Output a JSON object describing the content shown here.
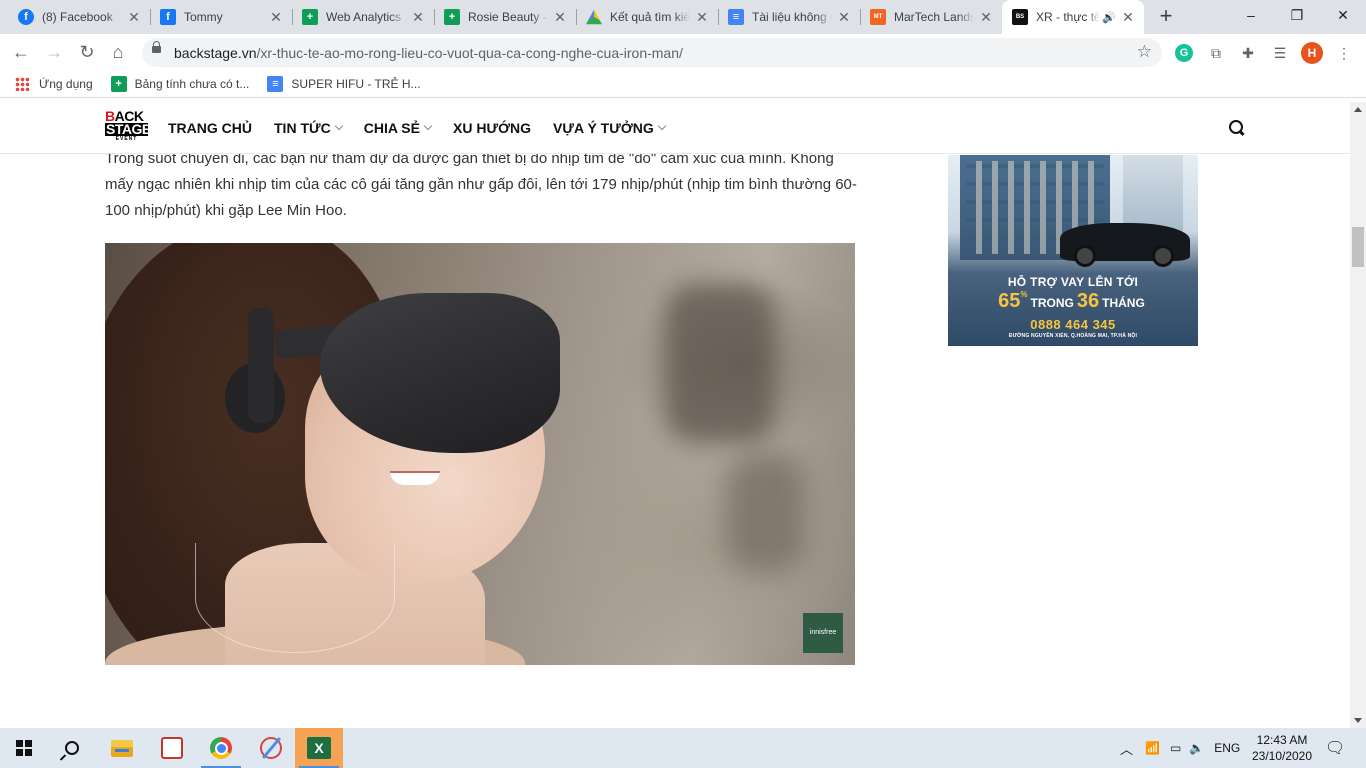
{
  "browser": {
    "tabs": [
      {
        "title": "(8) Facebook",
        "favicon": "facebook-icon"
      },
      {
        "title": "Tommy",
        "favicon": "facebook-icon"
      },
      {
        "title": "Web Analytics",
        "favicon": "google-sheets-icon"
      },
      {
        "title": "Rosie Beauty -",
        "favicon": "google-sheets-icon"
      },
      {
        "title": "Kết quả tìm kiếm",
        "favicon": "google-drive-icon"
      },
      {
        "title": "Tài liệu không có",
        "favicon": "google-docs-icon"
      },
      {
        "title": "MarTech Landscape",
        "favicon": "martech-icon"
      },
      {
        "title": "XR - thực tế",
        "favicon": "backstage-icon",
        "active": true,
        "audio": true
      }
    ],
    "url_domain": "backstage.vn",
    "url_path": "/xr-thuc-te-ao-mo-rong-lieu-co-vuot-qua-ca-cong-nghe-cua-iron-man/",
    "profile_initial": "H",
    "bookmarks": [
      {
        "label": "Ứng dụng",
        "icon": "apps-grid-icon"
      },
      {
        "label": "Bảng tính chưa có t...",
        "icon": "google-sheets-icon"
      },
      {
        "label": "SUPER HIFU - TRẺ H...",
        "icon": "google-docs-icon"
      }
    ]
  },
  "site": {
    "logo": {
      "line1_a": "B",
      "line1_b": "ACK",
      "line2": "STAGE",
      "line3": "EVENT"
    },
    "menu": [
      {
        "label": "TRANG CHỦ",
        "dropdown": false
      },
      {
        "label": "TIN TỨC",
        "dropdown": true
      },
      {
        "label": "CHIA SẺ",
        "dropdown": true
      },
      {
        "label": "XU HƯỚNG",
        "dropdown": false
      },
      {
        "label": "VỰA Ý TƯỞNG",
        "dropdown": true
      }
    ]
  },
  "article": {
    "paragraph": "Trong suốt chuyến đi, các bạn nữ tham dự đã được gắn thiết bị đo nhịp tim để \"đo\" cảm xúc của mình. Không mấy ngạc nhiên khi nhịp tim của các cô gái tăng gần như gấp đôi, lên tới 179 nhịp/phút (nhịp tim bình thường 60-100 nhịp/phút) khi gặp Lee Min Hoo.",
    "image_watermark": "innisfree",
    "headset_brand": "innisfree"
  },
  "ad": {
    "title": "HỖ TRỢ VAY LÊN TỚI",
    "percent": "65",
    "percent_sign": "%",
    "trong": "TRONG",
    "months": "36",
    "thang": "THÁNG",
    "phone": "0888 464 345",
    "address": "ĐƯỜNG NGUYỄN XIỂN, Q.HOÀNG MAI, TP.HÀ NỘI"
  },
  "taskbar": {
    "language": "ENG",
    "time": "12:43 AM",
    "date": "23/10/2020"
  },
  "colors": {
    "accent": "#d71920",
    "tab_strip": "#dee1e6",
    "taskbar": "#dfe8f0",
    "ad_gold": "#f5c542"
  }
}
